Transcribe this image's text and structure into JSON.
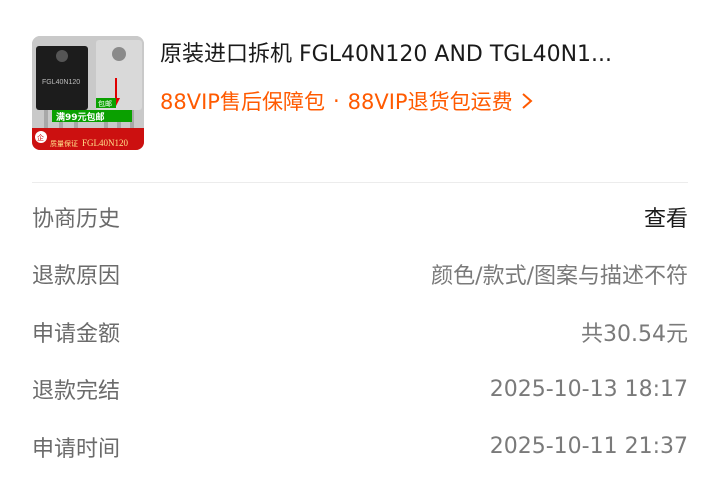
{
  "product": {
    "title": "原装进口拆机 FGL40N120 AND TGL40N1...",
    "service_left": "88VIP售后保障包",
    "service_separator": "·",
    "service_right": "88VIP退货包运费",
    "thumbnail": {
      "promo_text": "满99元包邮",
      "small_badge": "包邮",
      "quality_text": "质量保证",
      "model_text": "FGL40N120",
      "logo_text": "企",
      "chip_print": "FGL40N120"
    }
  },
  "details": [
    {
      "label": "协商历史",
      "value": "查看"
    },
    {
      "label": "退款原因",
      "value": "颜色/款式/图案与描述不符"
    },
    {
      "label": "申请金额",
      "value": "共30.54元"
    },
    {
      "label": "退款完结",
      "value": "2025-10-13 18:17"
    },
    {
      "label": "申请时间",
      "value": "2025-10-11 21:37"
    }
  ],
  "colors": {
    "accent": "#ff5a00",
    "label": "#6b6b6b",
    "value": "#7a7a7a",
    "divider": "#ececec"
  }
}
